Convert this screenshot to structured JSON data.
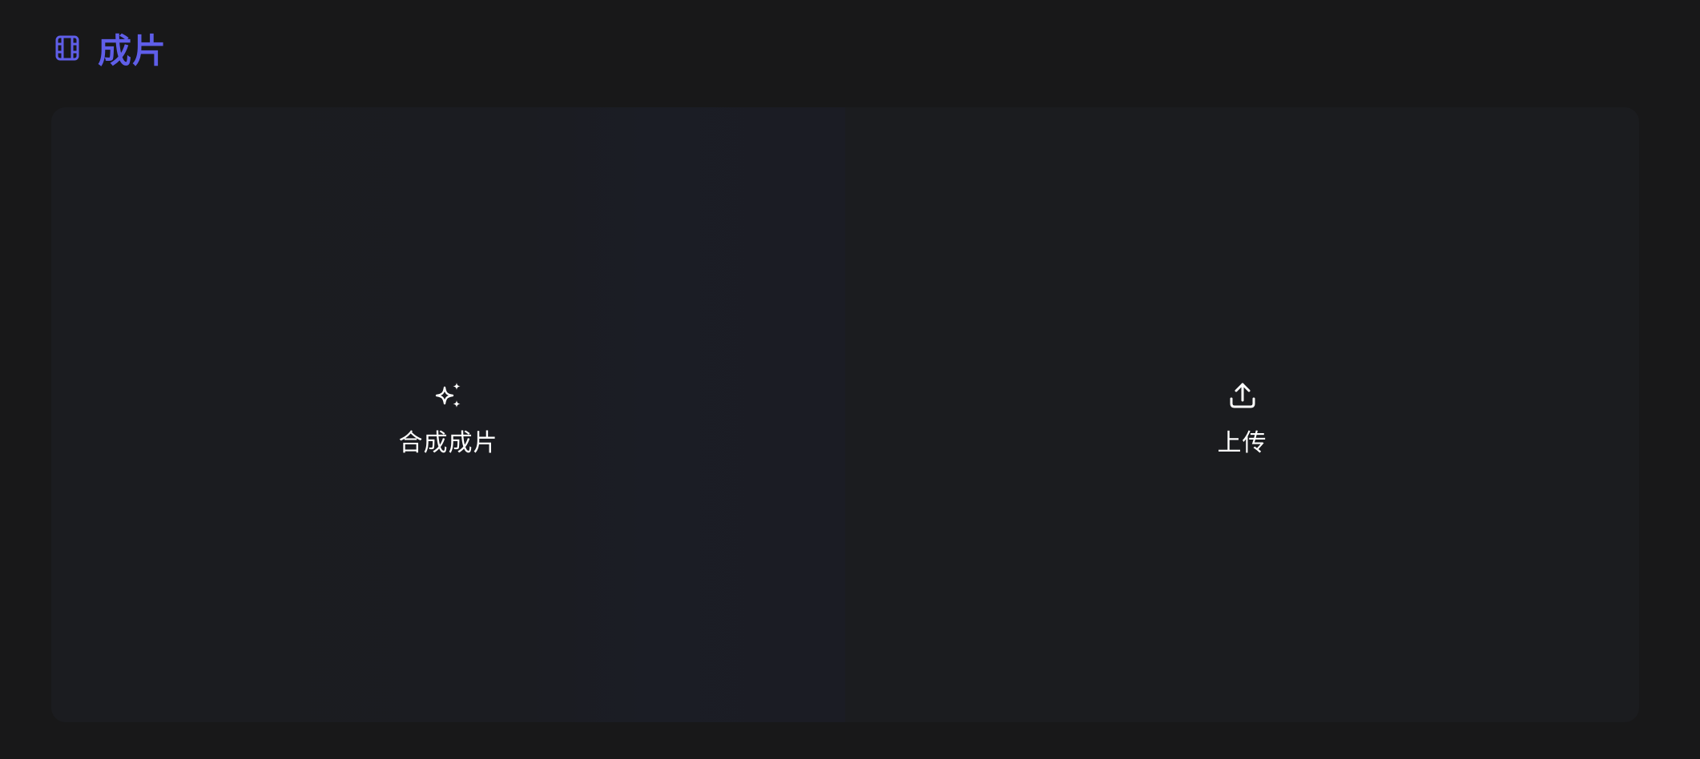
{
  "header": {
    "icon": "film-icon",
    "title": "成片"
  },
  "actions": [
    {
      "icon": "sparkles-icon",
      "label": "合成成片"
    },
    {
      "icon": "upload-icon",
      "label": "上传"
    }
  ],
  "colors": {
    "accent": "#5f5ee8",
    "background": "#181819",
    "panel": "#1b1c1f",
    "text": "#ffffff"
  }
}
